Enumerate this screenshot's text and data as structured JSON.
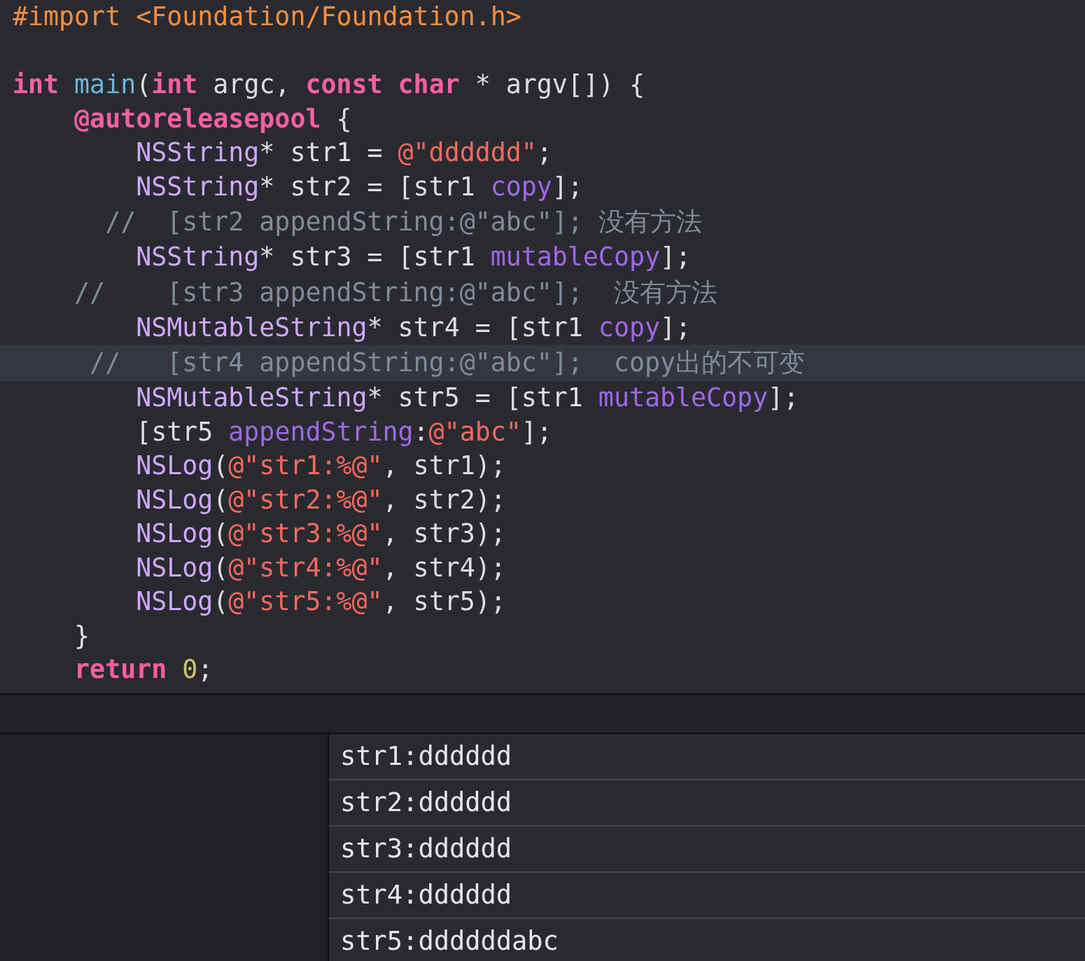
{
  "editor": {
    "lines": [
      {
        "highlighted": false,
        "tokens": [
          {
            "kind": "preprocessor",
            "text": "#import <Foundation/Foundation.h>"
          }
        ]
      },
      {
        "highlighted": false,
        "tokens": [
          {
            "kind": "keyword",
            "text": "int"
          },
          {
            "kind": "function",
            "text": " main"
          },
          {
            "kind": "plain",
            "text": "("
          },
          {
            "kind": "keyword",
            "text": "int"
          },
          {
            "kind": "plain",
            "text": " argc, "
          },
          {
            "kind": "keyword",
            "text": "const char"
          },
          {
            "kind": "plain",
            "text": " * argv[]) {"
          }
        ]
      },
      {
        "highlighted": false,
        "tokens": [
          {
            "kind": "keyword",
            "text": "    @autoreleasepool"
          },
          {
            "kind": "plain",
            "text": " {"
          }
        ]
      },
      {
        "highlighted": false,
        "tokens": [
          {
            "kind": "type",
            "text": "        NSString"
          },
          {
            "kind": "plain",
            "text": "* str1 = "
          },
          {
            "kind": "string",
            "text": "@\"dddddd\""
          },
          {
            "kind": "plain",
            "text": ";"
          }
        ]
      },
      {
        "highlighted": false,
        "tokens": [
          {
            "kind": "type",
            "text": "        NSString"
          },
          {
            "kind": "plain",
            "text": "* str2 = [str1 "
          },
          {
            "kind": "method",
            "text": "copy"
          },
          {
            "kind": "plain",
            "text": "];"
          }
        ]
      },
      {
        "highlighted": false,
        "tokens": [
          {
            "kind": "comment",
            "text": "      //  [str2 appendString:@\"abc\"]; 没有方法"
          }
        ]
      },
      {
        "highlighted": false,
        "tokens": [
          {
            "kind": "type",
            "text": "        NSString"
          },
          {
            "kind": "plain",
            "text": "* str3 = [str1 "
          },
          {
            "kind": "method",
            "text": "mutableCopy"
          },
          {
            "kind": "plain",
            "text": "];"
          }
        ]
      },
      {
        "highlighted": false,
        "tokens": [
          {
            "kind": "comment",
            "text": "    //    [str3 appendString:@\"abc\"];  没有方法"
          }
        ]
      },
      {
        "highlighted": false,
        "tokens": [
          {
            "kind": "type",
            "text": "        NSMutableString"
          },
          {
            "kind": "plain",
            "text": "* str4 = [str1 "
          },
          {
            "kind": "method",
            "text": "copy"
          },
          {
            "kind": "plain",
            "text": "];"
          }
        ]
      },
      {
        "highlighted": true,
        "tokens": [
          {
            "kind": "comment",
            "text": "     //   [str4 appendString:@\"abc\"];  copy出的不可变"
          }
        ]
      },
      {
        "highlighted": false,
        "tokens": [
          {
            "kind": "type",
            "text": "        NSMutableString"
          },
          {
            "kind": "plain",
            "text": "* str5 = [str1 "
          },
          {
            "kind": "method",
            "text": "mutableCopy"
          },
          {
            "kind": "plain",
            "text": "];"
          }
        ]
      },
      {
        "highlighted": false,
        "tokens": [
          {
            "kind": "plain",
            "text": "        [str5 "
          },
          {
            "kind": "method",
            "text": "appendString"
          },
          {
            "kind": "plain",
            "text": ":"
          },
          {
            "kind": "string",
            "text": "@\"abc\""
          },
          {
            "kind": "plain",
            "text": "];"
          }
        ]
      },
      {
        "highlighted": false,
        "tokens": [
          {
            "kind": "type",
            "text": "        NSLog"
          },
          {
            "kind": "plain",
            "text": "("
          },
          {
            "kind": "string",
            "text": "@\"str1:%@\""
          },
          {
            "kind": "plain",
            "text": ", str1);"
          }
        ]
      },
      {
        "highlighted": false,
        "tokens": [
          {
            "kind": "type",
            "text": "        NSLog"
          },
          {
            "kind": "plain",
            "text": "("
          },
          {
            "kind": "string",
            "text": "@\"str2:%@\""
          },
          {
            "kind": "plain",
            "text": ", str2);"
          }
        ]
      },
      {
        "highlighted": false,
        "tokens": [
          {
            "kind": "type",
            "text": "        NSLog"
          },
          {
            "kind": "plain",
            "text": "("
          },
          {
            "kind": "string",
            "text": "@\"str3:%@\""
          },
          {
            "kind": "plain",
            "text": ", str3);"
          }
        ]
      },
      {
        "highlighted": false,
        "tokens": [
          {
            "kind": "type",
            "text": "        NSLog"
          },
          {
            "kind": "plain",
            "text": "("
          },
          {
            "kind": "string",
            "text": "@\"str4:%@\""
          },
          {
            "kind": "plain",
            "text": ", str4);"
          }
        ]
      },
      {
        "highlighted": false,
        "tokens": [
          {
            "kind": "type",
            "text": "        NSLog"
          },
          {
            "kind": "plain",
            "text": "("
          },
          {
            "kind": "string",
            "text": "@\"str5:%@\""
          },
          {
            "kind": "plain",
            "text": ", str5);"
          }
        ]
      },
      {
        "highlighted": false,
        "tokens": [
          {
            "kind": "plain",
            "text": "    }"
          }
        ]
      },
      {
        "highlighted": false,
        "tokens": [
          {
            "kind": "keyword",
            "text": "    return"
          },
          {
            "kind": "number",
            "text": " 0"
          },
          {
            "kind": "plain",
            "text": ";"
          }
        ]
      }
    ]
  },
  "console": {
    "lines": [
      "str1:dddddd",
      "str2:dddddd",
      "str3:dddddd",
      "str4:dddddd",
      "str5:ddddddabc"
    ]
  }
}
